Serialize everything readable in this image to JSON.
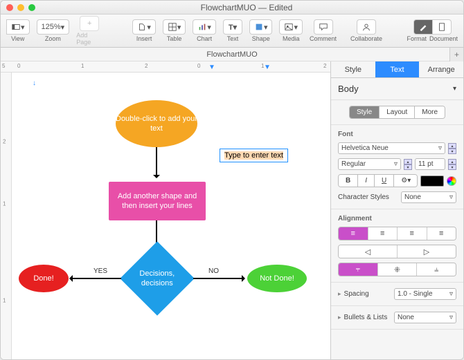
{
  "title": "FlowchartMUO — Edited",
  "doc_tab": "FlowchartMUO",
  "toolbar": {
    "view": "View",
    "zoom": "Zoom",
    "zoom_value": "125%",
    "add_page": "Add Page",
    "insert": "Insert",
    "table": "Table",
    "chart": "Chart",
    "text": "Text",
    "shape": "Shape",
    "media": "Media",
    "comment": "Comment",
    "collaborate": "Collaborate",
    "format": "Format",
    "document": "Document"
  },
  "ruler_h": [
    "5",
    "0",
    "1",
    "2",
    "0",
    "1",
    "2"
  ],
  "ruler_v": [
    "2",
    "1",
    "1"
  ],
  "flow": {
    "start": "Double-click to add your text",
    "process": "Add another shape and then insert your lines",
    "decision": "Decisions, decisions",
    "done": "Done!",
    "notdone": "Not Done!",
    "yes": "YES",
    "no": "NO",
    "textbox": "Type to enter text"
  },
  "sidebar": {
    "tabs": {
      "style": "Style",
      "text": "Text",
      "arrange": "Arrange"
    },
    "para_style": "Body",
    "subtabs": {
      "style": "Style",
      "layout": "Layout",
      "more": "More"
    },
    "font_hdr": "Font",
    "font_name": "Helvetica Neue",
    "font_weight": "Regular",
    "font_size": "11 pt",
    "bold": "B",
    "italic": "I",
    "underline": "U",
    "charstyles_lbl": "Character Styles",
    "charstyles_val": "None",
    "align_hdr": "Alignment",
    "spacing_lbl": "Spacing",
    "spacing_val": "1.0 - Single",
    "bullets_lbl": "Bullets & Lists",
    "bullets_val": "None"
  }
}
